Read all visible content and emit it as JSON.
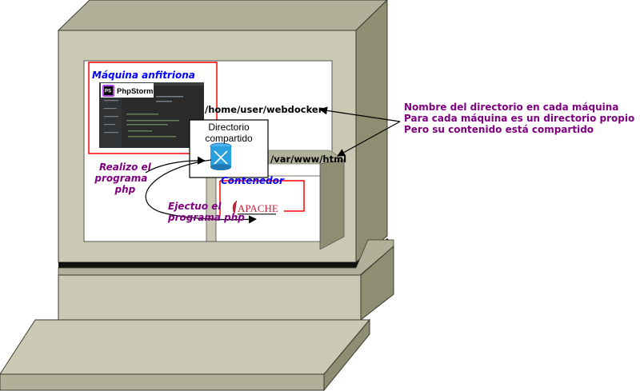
{
  "host_label": "Máquina anfitriona",
  "ide_logo": {
    "badge": "PS",
    "name": "PhpStorm"
  },
  "shared_dir_label": {
    "line1": "Directorio",
    "line2": "compartido"
  },
  "host_path": "/home/user/webdocker",
  "container_path": "/var/www/html",
  "container_label": "Contenedor",
  "apache_logo": "APACHE",
  "host_action": {
    "line1": "Realizo el",
    "line2": "programa",
    "line3": "php"
  },
  "container_action": {
    "line1": "Ejectuo el",
    "line2": "programa php"
  },
  "explanation": [
    "Nombre del directorio en cada máquina",
    "Para cada máquina  es un directorio propio",
    "Pero su contenido está compartido"
  ],
  "icons": [
    "phpstorm-icon",
    "shared-folder-icon",
    "apache-feather-icon"
  ],
  "colors": {
    "case": "#c9c9b4",
    "case_side": "#8f8f72",
    "case_top": "#b1b19a",
    "highlight": "#ff0000",
    "accent_purple": "#800080",
    "accent_blue": "#0000ff"
  }
}
